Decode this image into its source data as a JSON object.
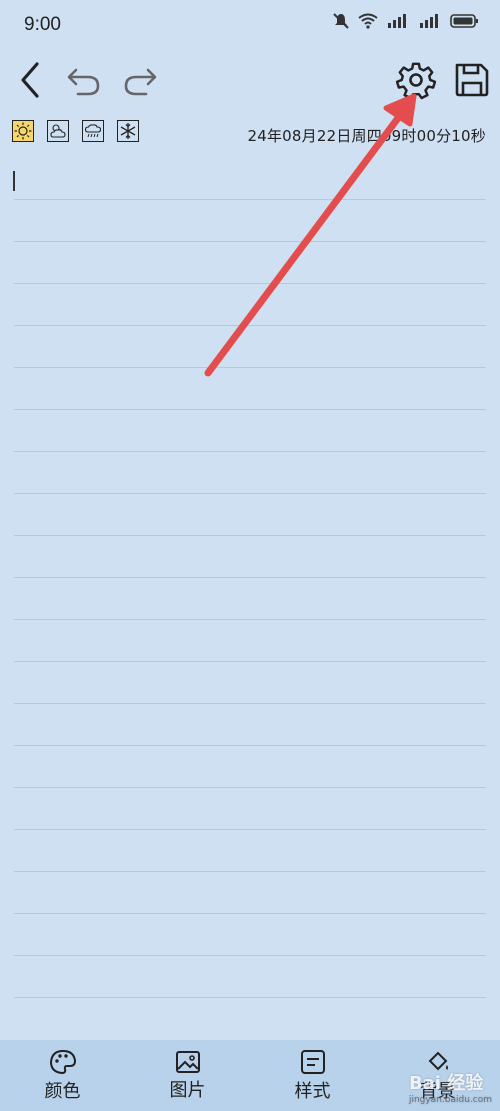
{
  "status_bar": {
    "time": "9:00",
    "icons": [
      "mute-icon",
      "wifi-icon",
      "signal-icon-1",
      "signal-icon-2",
      "battery-icon"
    ]
  },
  "toolbar": {
    "back": "back-icon",
    "undo": "undo-icon",
    "redo": "redo-icon",
    "settings": "gear-icon",
    "save": "save-icon"
  },
  "weather": {
    "options": [
      "sunny",
      "partly-cloudy",
      "rainy",
      "snowy"
    ],
    "selected": "sunny",
    "selected_color": "#f6d66a"
  },
  "datetime": "24年08月22日周四09时00分10秒",
  "editor": {
    "content": "",
    "background_color": "#cfe0f3"
  },
  "bottom_nav": {
    "items": [
      {
        "label": "颜色",
        "icon": "palette-icon"
      },
      {
        "label": "图片",
        "icon": "image-icon"
      },
      {
        "label": "样式",
        "icon": "style-icon"
      },
      {
        "label": "背景",
        "icon": "background-icon"
      }
    ]
  },
  "watermark": {
    "text": "Bai 经验",
    "sub": "jingyan.baidu.com"
  },
  "annotation_color": "#e34d4d"
}
